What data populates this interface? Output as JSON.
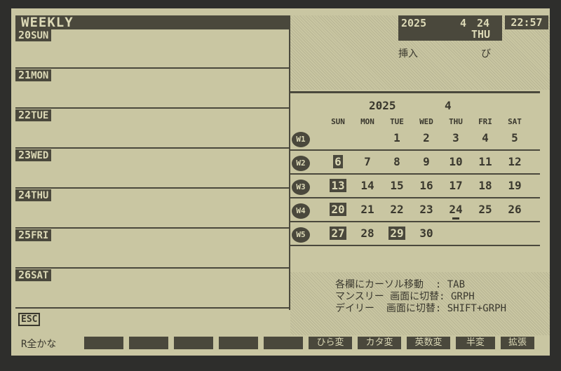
{
  "weekly": {
    "title": "WEEKLY",
    "days": [
      {
        "num": "20",
        "dow": "SUN"
      },
      {
        "num": "21",
        "dow": "MON"
      },
      {
        "num": "22",
        "dow": "TUE"
      },
      {
        "num": "23",
        "dow": "WED"
      },
      {
        "num": "24",
        "dow": "THU"
      },
      {
        "num": "25",
        "dow": "FRI"
      },
      {
        "num": "26",
        "dow": "SAT"
      }
    ]
  },
  "header": {
    "year": "2025",
    "month": "4",
    "day": "24",
    "dow": "THU",
    "time": "22:57",
    "insert_label": "挿入",
    "caps_indicator": "び"
  },
  "calendar": {
    "year": "2025",
    "month": "4",
    "weekdays": [
      "SUN",
      "MON",
      "TUE",
      "WED",
      "THU",
      "FRI",
      "SAT"
    ],
    "weeks": [
      {
        "label": "W1",
        "days": [
          "",
          "",
          "1",
          "2",
          "3",
          "4",
          "5"
        ]
      },
      {
        "label": "W2",
        "days": [
          "6",
          "7",
          "8",
          "9",
          "10",
          "11",
          "12"
        ]
      },
      {
        "label": "W3",
        "days": [
          "13",
          "14",
          "15",
          "16",
          "17",
          "18",
          "19"
        ]
      },
      {
        "label": "W4",
        "days": [
          "20",
          "21",
          "22",
          "23",
          "24",
          "25",
          "26"
        ]
      },
      {
        "label": "W5",
        "days": [
          "27",
          "28",
          "29",
          "30",
          "",
          "",
          ""
        ]
      }
    ],
    "highlighted_days": [
      "6",
      "13",
      "20",
      "27",
      "29"
    ],
    "today": "24"
  },
  "help": {
    "line1": "各欄にカーソル移動  : TAB",
    "line2": "マンスリー 画面に切替: GRPH",
    "line3": "デイリー  画面に切替: SHIFT+GRPH"
  },
  "esc_label": "ESC",
  "fbar": {
    "mode": "R全かな",
    "keys": [
      "",
      "",
      "",
      "",
      "",
      "ひら変",
      "カタ変",
      "英数変",
      "半変",
      "拡張"
    ]
  }
}
